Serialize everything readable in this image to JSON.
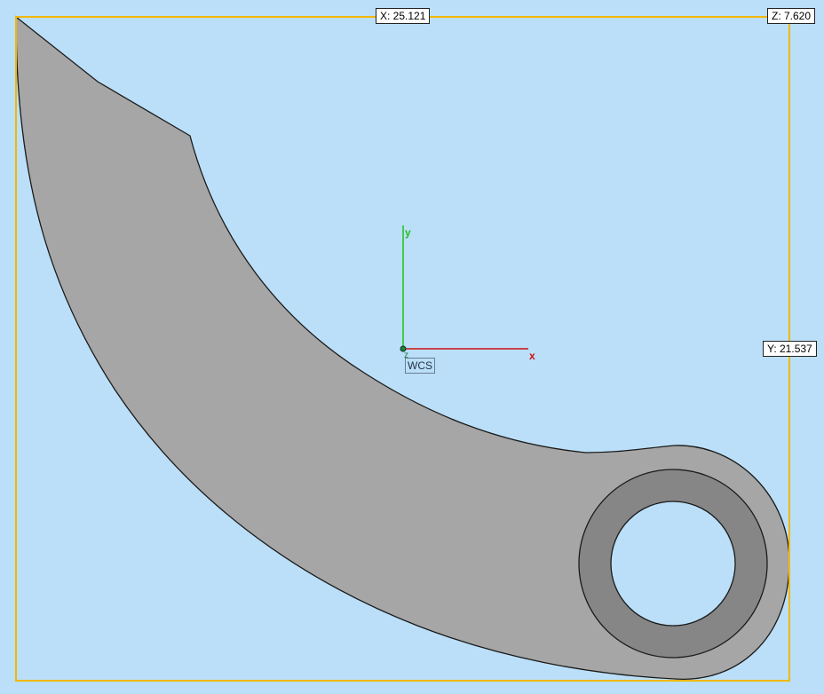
{
  "dimensions": {
    "x_label": "X: 25.121",
    "y_label": "Y: 21.537",
    "z_label": "Z: 7.620"
  },
  "axes": {
    "x": "x",
    "y": "y",
    "z": "z",
    "frame_label": "WCS"
  },
  "colors": {
    "background": "#bbdff8",
    "bounding_box": "#f2b705",
    "part_fill": "#a6a6a6",
    "boss_ring_fill": "#868686",
    "outline": "#1a1a1a",
    "x_axis": "#d01010",
    "y_axis": "#20c020",
    "z_origin": "#208040"
  },
  "icons": {
    "origin": "origin-marker-icon"
  }
}
